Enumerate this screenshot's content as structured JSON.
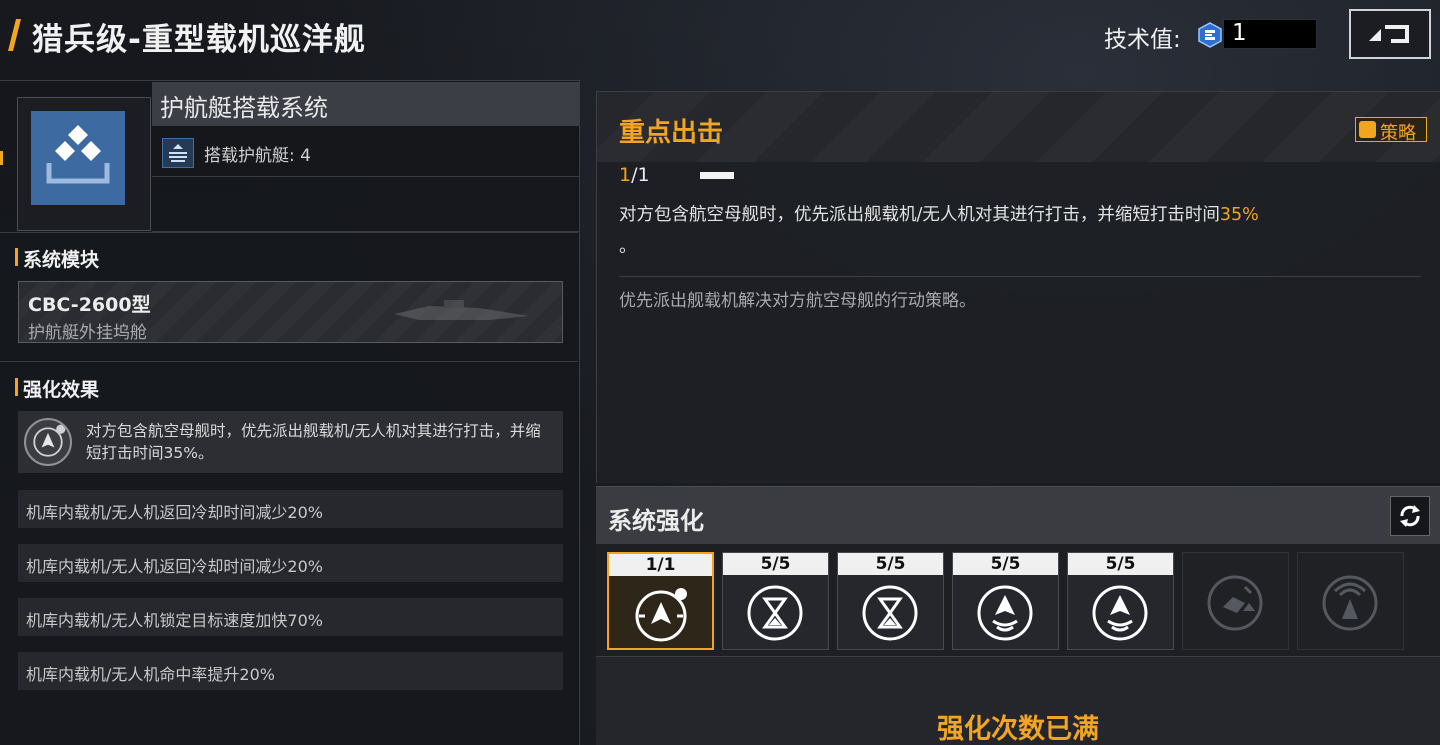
{
  "header": {
    "title": "猎兵级-重型载机巡洋舰",
    "tech_label": "技术值:",
    "tech_value": "1"
  },
  "left": {
    "system_name": "护航艇搭载系统",
    "stat_label": "搭载护航艇: 4",
    "module_section": "系统模块",
    "module_name": "CBC-2600型",
    "module_sub": "护航艇外挂坞舱",
    "effect_section": "强化效果",
    "effect_main": "对方包含航空母舰时，优先派出舰载机/无人机对其进行打击，并缩短打击时间35%。",
    "effects": [
      "机库内载机/无人机返回冷却时间减少20%",
      "机库内载机/无人机返回冷却时间减少20%",
      "机库内载机/无人机锁定目标速度加快70%",
      "机库内载机/无人机命中率提升20%"
    ]
  },
  "detail": {
    "title": "重点出击",
    "badge": "策略",
    "level_current": "1",
    "level_sep_max": "/1",
    "desc_main": "对方包含航空母舰时，优先派出舰载机/无人机对其进行打击，并缩短打击时间",
    "desc_pct": "35%",
    "desc_end": "。",
    "desc_sub": "优先派出舰载机解决对方航空母舰的行动策略。"
  },
  "enhance": {
    "title": "系统强化",
    "slots": [
      {
        "level": "1/1",
        "icon": "strike-target-icon",
        "active": true
      },
      {
        "level": "5/5",
        "icon": "hourglass-cooldown-icon"
      },
      {
        "level": "5/5",
        "icon": "hourglass-cooldown-icon"
      },
      {
        "level": "5/5",
        "icon": "aircraft-signal-icon"
      },
      {
        "level": "5/5",
        "icon": "aircraft-signal-icon"
      },
      {
        "level": "",
        "icon": "repair-up-icon",
        "locked": true
      },
      {
        "level": "",
        "icon": "radar-broadcast-icon",
        "locked": true
      }
    ],
    "maxed_text": "强化次数已满"
  },
  "colors": {
    "accent": "#f2a520",
    "module_blue": "#3d6aa0"
  }
}
